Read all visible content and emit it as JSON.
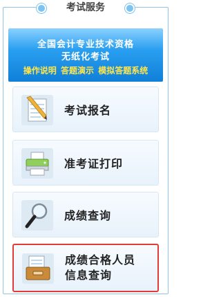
{
  "header": {
    "title": "考试服务"
  },
  "banner": {
    "line1": "全国会计专业技术资格",
    "line2": "无纸化考试",
    "links": [
      "操作说明",
      "答题演示",
      "模拟答题系统"
    ]
  },
  "services": [
    {
      "label": "考试报名",
      "icon": "notepad-pencil-icon"
    },
    {
      "label": "准考证打印",
      "icon": "printer-icon"
    },
    {
      "label": "成绩查询",
      "icon": "magnifier-icon"
    },
    {
      "label_line1": "成绩合格人员",
      "label_line2": "信息查询",
      "icon": "file-drawer-icon",
      "highlight_color": "#e23a36"
    }
  ]
}
